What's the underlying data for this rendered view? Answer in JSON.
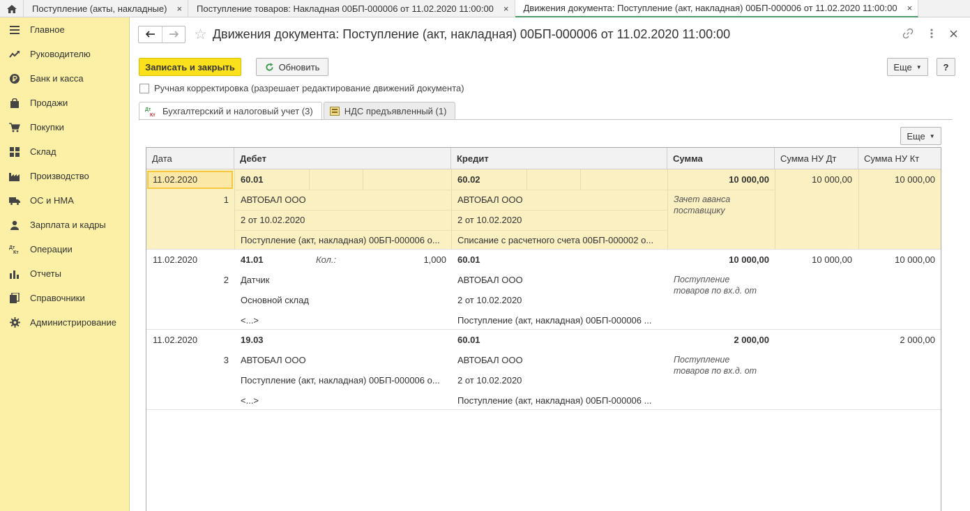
{
  "top_tabs": [
    {
      "label": "Поступление (акты, накладные)"
    },
    {
      "label": "Поступление товаров: Накладная 00БП-000006 от 11.02.2020 11:00:00"
    },
    {
      "label": "Движения документа: Поступление (акт, накладная) 00БП-000006 от 11.02.2020 11:00:00"
    }
  ],
  "close_glyph": "×",
  "sidebar": {
    "items": [
      {
        "label": "Главное",
        "icon": "menu-icon"
      },
      {
        "label": "Руководителю",
        "icon": "trend-icon"
      },
      {
        "label": "Банк и касса",
        "icon": "ruble-icon"
      },
      {
        "label": "Продажи",
        "icon": "bag-icon"
      },
      {
        "label": "Покупки",
        "icon": "cart-icon"
      },
      {
        "label": "Склад",
        "icon": "grid-icon"
      },
      {
        "label": "Производство",
        "icon": "factory-icon"
      },
      {
        "label": "ОС и НМА",
        "icon": "truck-icon"
      },
      {
        "label": "Зарплата и кадры",
        "icon": "person-icon"
      },
      {
        "label": "Операции",
        "icon": "dt-kt-icon"
      },
      {
        "label": "Отчеты",
        "icon": "bar-chart-icon"
      },
      {
        "label": "Справочники",
        "icon": "book-icon"
      },
      {
        "label": "Администрирование",
        "icon": "gear-icon"
      }
    ]
  },
  "header": {
    "title": "Движения документа: Поступление (акт, накладная) 00БП-000006 от 11.02.2020 11:00:00"
  },
  "toolbar": {
    "save_close": "Записать и закрыть",
    "refresh": "Обновить",
    "more": "Еще",
    "help": "?"
  },
  "manual_edit": {
    "label": "Ручная корректировка (разрешает редактирование движений документа)",
    "checked": false
  },
  "form_tabs": [
    {
      "label": "Бухгалтерский и налоговый учет (3)",
      "icon_top": "Дт",
      "icon_bottom": "Кт"
    },
    {
      "label": "НДС предъявленный (1)"
    }
  ],
  "table": {
    "more": "Еще",
    "columns": [
      "Дата",
      "Дебет",
      "Кредит",
      "Сумма",
      "Сумма НУ Дт",
      "Сумма НУ Кт"
    ],
    "rows": [
      {
        "date": "11.02.2020",
        "num": "1",
        "debit": [
          "60.01",
          "АВТОБАЛ ООО",
          "2 от 10.02.2020",
          "Поступление (акт, накладная) 00БП-000006 о..."
        ],
        "debit_qty_label": "",
        "debit_qty": "",
        "credit": [
          "60.02",
          "АВТОБАЛ ООО",
          "2 от 10.02.2020",
          "Списание с расчетного счета 00БП-000002 о..."
        ],
        "sum": "10 000,00",
        "content": "Зачет аванса\nпоставщику",
        "nu_dt": "10 000,00",
        "nu_kt": "10 000,00"
      },
      {
        "date": "11.02.2020",
        "num": "2",
        "debit": [
          "41.01",
          "Датчик",
          "Основной склад",
          "<...>"
        ],
        "debit_qty_label": "Кол.:",
        "debit_qty": "1,000",
        "credit": [
          "60.01",
          "АВТОБАЛ ООО",
          "2 от 10.02.2020",
          "Поступление (акт, накладная) 00БП-000006 ..."
        ],
        "sum": "10 000,00",
        "content": "Поступление\nтоваров по вх.д.  от",
        "nu_dt": "10 000,00",
        "nu_kt": "10 000,00"
      },
      {
        "date": "11.02.2020",
        "num": "3",
        "debit": [
          "19.03",
          "АВТОБАЛ ООО",
          "Поступление (акт, накладная) 00БП-000006 о...",
          "<...>"
        ],
        "debit_qty_label": "",
        "debit_qty": "",
        "credit": [
          "60.01",
          "АВТОБАЛ ООО",
          "2 от 10.02.2020",
          "Поступление (акт, накладная) 00БП-000006 ..."
        ],
        "sum": "2 000,00",
        "content": "Поступление\nтоваров по вх.д.  от",
        "nu_dt": "",
        "nu_kt": "2 000,00"
      }
    ]
  }
}
